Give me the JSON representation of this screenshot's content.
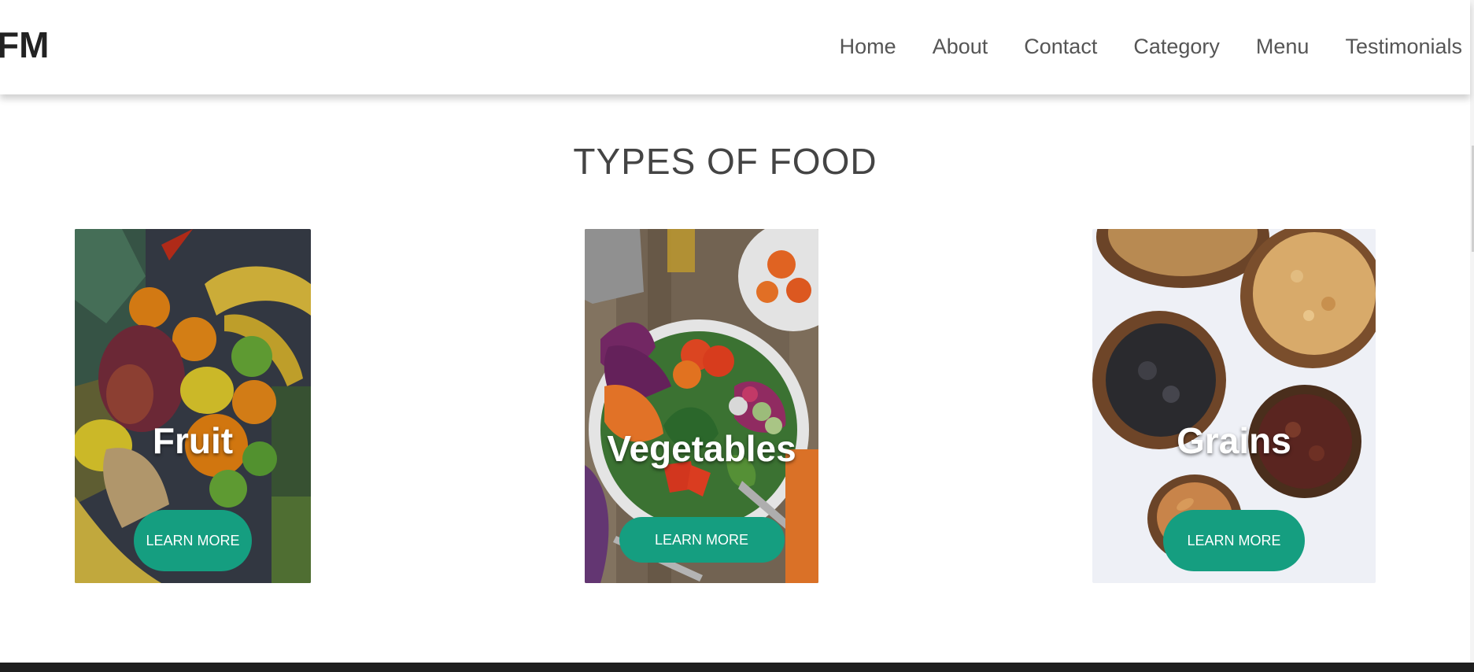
{
  "logo": {
    "text": "FM"
  },
  "nav": {
    "items": [
      "Home",
      "About",
      "Contact",
      "Category",
      "Menu",
      "Testimonials"
    ]
  },
  "section": {
    "title": "TYPES OF FOOD"
  },
  "cards": [
    {
      "label": "Fruit",
      "button": "LEARN MORE",
      "image": "fruit-photo"
    },
    {
      "label": "Vegetables",
      "button": "LEARN MORE",
      "image": "vegetable-salad-photo"
    },
    {
      "label": "Grains",
      "button": "LEARN MORE",
      "image": "grains-nuts-bowls-photo"
    }
  ],
  "colors": {
    "accent": "#159e80",
    "title": "#444444",
    "nav_text": "#555555"
  }
}
